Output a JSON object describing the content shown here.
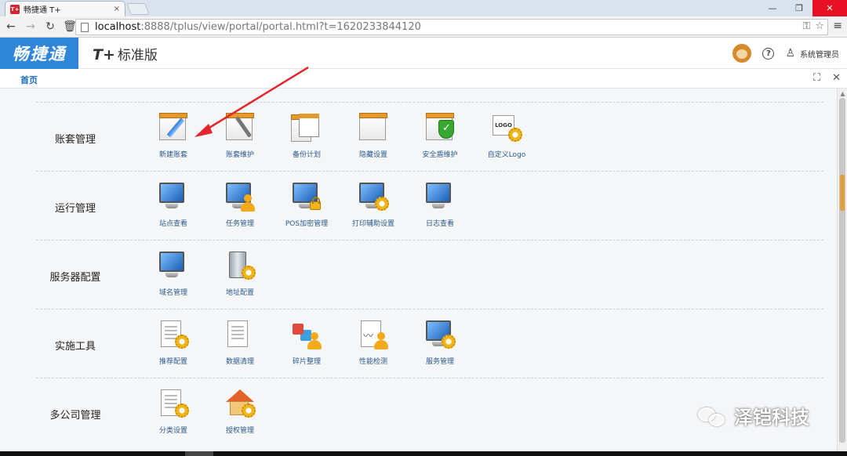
{
  "browser": {
    "tab_title": "畅捷通 T+",
    "tab_close": "×",
    "favicon_text": "T+",
    "url_host": "localhost",
    "url_path": ":8888/tplus/view/portal/portal.html?t=1620233844120",
    "window_controls": {
      "minimize": "—",
      "maximize": "❐",
      "close": "✕"
    }
  },
  "header": {
    "logo_text": "畅捷通",
    "edition_prefix": "T+",
    "edition_name": "标准版",
    "help_glyph": "?",
    "user_glyph": "♙",
    "username": "系统管理员"
  },
  "page_tabs": {
    "active": "首页",
    "fullscreen_glyph": "⛶",
    "close_glyph": "✕"
  },
  "sections": [
    {
      "title": "账套管理",
      "items": [
        {
          "label": "新建账套",
          "icon": "ledger-pencil-icon"
        },
        {
          "label": "账套维护",
          "icon": "ledger-wrench-icon"
        },
        {
          "label": "备份计划",
          "icon": "calendar-backup-icon"
        },
        {
          "label": "隐藏设置",
          "icon": "ledger-hidden-icon"
        },
        {
          "label": "安全盾维护",
          "icon": "security-shield-icon"
        },
        {
          "label": "自定义Logo",
          "icon": "logo-gear-icon",
          "logo_text": "LOGO"
        }
      ]
    },
    {
      "title": "运行管理",
      "items": [
        {
          "label": "站点查看",
          "icon": "monitor-icon"
        },
        {
          "label": "任务管理",
          "icon": "monitor-user-icon"
        },
        {
          "label": "POS加密管理",
          "icon": "monitor-lock-icon"
        },
        {
          "label": "打印辅助设置",
          "icon": "monitor-gear-icon"
        },
        {
          "label": "日志查看",
          "icon": "monitor-log-icon"
        }
      ]
    },
    {
      "title": "服务器配置",
      "items": [
        {
          "label": "域名管理",
          "icon": "monitor-domain-icon"
        },
        {
          "label": "地址配置",
          "icon": "server-gear-icon"
        }
      ]
    },
    {
      "title": "实施工具",
      "items": [
        {
          "label": "推荐配置",
          "icon": "document-gear-icon"
        },
        {
          "label": "数据清理",
          "icon": "document-clean-icon"
        },
        {
          "label": "碎片整理",
          "icon": "puzzle-user-icon"
        },
        {
          "label": "性能检测",
          "icon": "performance-user-icon"
        },
        {
          "label": "服务管理",
          "icon": "monitor-service-gear-icon"
        }
      ]
    },
    {
      "title": "多公司管理",
      "items": [
        {
          "label": "分类设置",
          "icon": "document-category-icon"
        },
        {
          "label": "授权管理",
          "icon": "house-gear-icon"
        }
      ]
    }
  ],
  "watermark": {
    "text": "泽铠科技"
  },
  "annotation": {
    "color": "#e3262b"
  }
}
